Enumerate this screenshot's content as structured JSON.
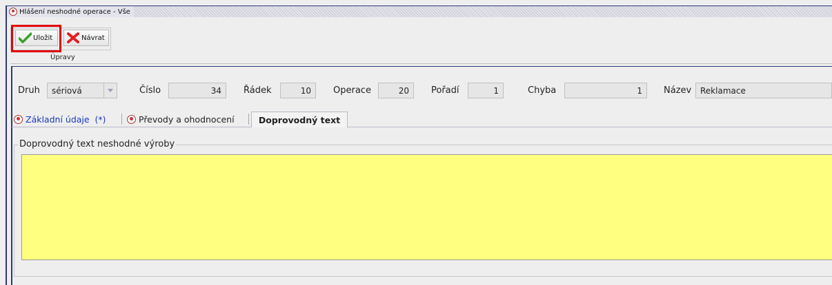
{
  "window": {
    "title": "Hlášení neshodné operace - Vše"
  },
  "toolbar": {
    "save_label": "Uložit",
    "back_label": "Návrat",
    "group_caption": "Úpravy"
  },
  "fields": {
    "druh_label": "Druh",
    "druh_value": "sériová",
    "cislo_label": "Číslo",
    "cislo_value": "34",
    "radek_label": "Řádek",
    "radek_value": "10",
    "operace_label": "Operace",
    "operace_value": "20",
    "poradi_label": "Pořadí",
    "poradi_value": "1",
    "chyba_label": "Chyba",
    "chyba_value": "1",
    "nazev_label": "Název",
    "nazev_value": "Reklamace"
  },
  "tabs": [
    {
      "label": "Základní údaje  (*)"
    },
    {
      "label": "Převody a ohodnocení"
    },
    {
      "label": "Doprovodný text"
    }
  ],
  "content": {
    "group_title": "Doprovodný text neshodné výroby",
    "text_value": ""
  },
  "colors": {
    "highlight": "#e00000",
    "textarea_bg": "#ffff80",
    "active_link": "#1a35c8"
  }
}
